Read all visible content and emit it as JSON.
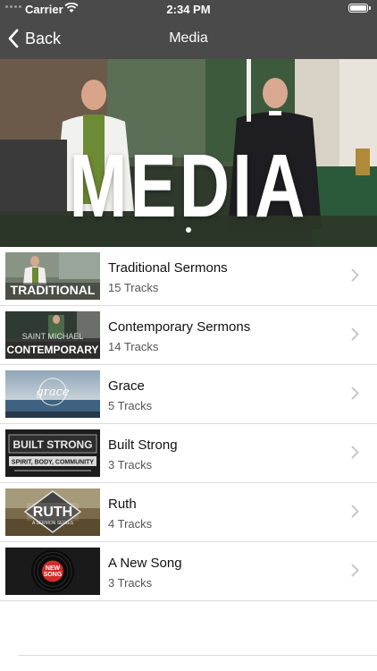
{
  "status_bar": {
    "carrier": "Carrier",
    "time": "2:34 PM",
    "icons": [
      "signal-dots-icon",
      "wifi-icon",
      "battery-icon"
    ]
  },
  "nav": {
    "back_label": "Back",
    "title": "Media",
    "back_icon": "chevron-left-icon"
  },
  "hero": {
    "text": "MEDIA"
  },
  "list": [
    {
      "title": "Traditional Sermons",
      "subtitle": "15 Tracks",
      "thumb_text": "TRADITIONAL"
    },
    {
      "title": "Contemporary Sermons",
      "subtitle": "14 Tracks",
      "thumb_text": "CONTEMPORARY",
      "thumb_text_2": "SAINT MICHAEL"
    },
    {
      "title": "Grace",
      "subtitle": "5 Tracks",
      "thumb_text": "grace"
    },
    {
      "title": "Built Strong",
      "subtitle": "3 Tracks",
      "thumb_text": "BUILT STRONG",
      "thumb_text_2": "SPIRIT, BODY, COMMUNITY"
    },
    {
      "title": "Ruth",
      "subtitle": "4 Tracks",
      "thumb_text": "RUTH",
      "thumb_text_2": "A SERMON SERIES"
    },
    {
      "title": "A New Song",
      "subtitle": "3 Tracks",
      "thumb_text": "NEW",
      "thumb_text_2": "SONG"
    }
  ],
  "colors": {
    "nav_bg": "#4a4a4a",
    "divider": "#dcdcdc",
    "chevron": "#c7c7cc"
  }
}
